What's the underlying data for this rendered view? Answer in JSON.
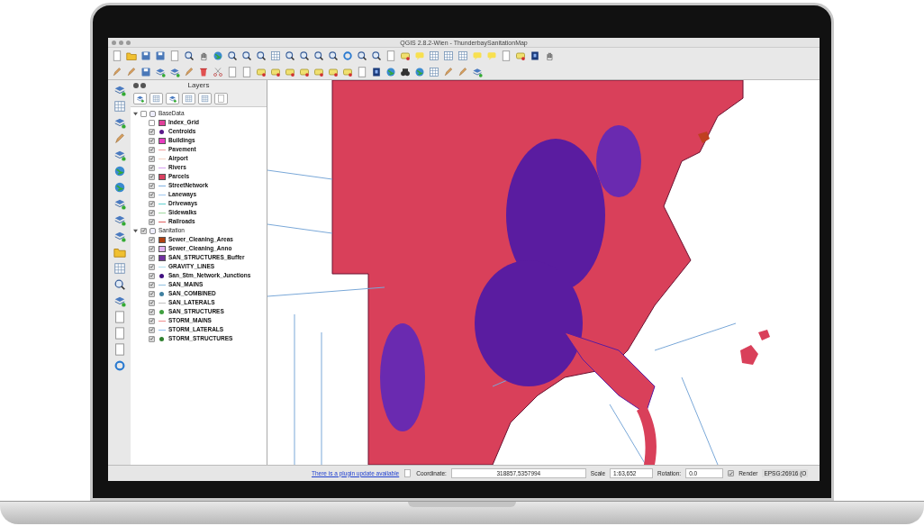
{
  "window": {
    "title": "QGIS 2.8.2-Wien - ThunderbaySanitationMap"
  },
  "layers_panel": {
    "title": "Layers",
    "groups": [
      {
        "name": "BaseData",
        "checked": false,
        "expanded": true,
        "children": [
          {
            "name": "Index_Grid",
            "checked": false,
            "kind": "fill",
            "color": "#e0409a"
          },
          {
            "name": "Centroids",
            "checked": true,
            "kind": "point",
            "color": "#5a1a8a"
          },
          {
            "name": "Buildings",
            "checked": true,
            "kind": "fill",
            "color": "#e83cc0"
          },
          {
            "name": "Pavement",
            "checked": true,
            "kind": "line",
            "color": "#f0a0a0"
          },
          {
            "name": "Airport",
            "checked": true,
            "kind": "line",
            "color": "#f5d0c0"
          },
          {
            "name": "Rivers",
            "checked": true,
            "kind": "line",
            "color": "#d8a0f0"
          },
          {
            "name": "Parcels",
            "checked": true,
            "kind": "fill",
            "color": "#d94060"
          },
          {
            "name": "StreetNetwork",
            "checked": true,
            "kind": "line",
            "color": "#80b0e0"
          },
          {
            "name": "Laneways",
            "checked": true,
            "kind": "line",
            "color": "#a0c8f0"
          },
          {
            "name": "Driveways",
            "checked": true,
            "kind": "line",
            "color": "#60d0d0"
          },
          {
            "name": "Sidewalks",
            "checked": true,
            "kind": "line",
            "color": "#a0d8a0"
          },
          {
            "name": "Railroads",
            "checked": true,
            "kind": "line",
            "color": "#e06060"
          }
        ]
      },
      {
        "name": "Sanitation",
        "checked": true,
        "expanded": true,
        "children": [
          {
            "name": "Sewer_Cleaning_Areas",
            "checked": true,
            "kind": "fill",
            "color": "#b04010"
          },
          {
            "name": "Sewer_Cleaning_Anno",
            "checked": true,
            "kind": "fill",
            "color": "#e0b0f0"
          },
          {
            "name": "SAN_STRUCTURES_Buffer",
            "checked": true,
            "kind": "fill",
            "color": "#7030a0"
          },
          {
            "name": "GRAVITY_LINES",
            "checked": true,
            "kind": "line",
            "color": "#b0e0f0"
          },
          {
            "name": "San_Stm_Network_Junctions",
            "checked": true,
            "kind": "point",
            "color": "#401080"
          },
          {
            "name": "SAN_MAINS",
            "checked": true,
            "kind": "line",
            "color": "#90c0e0"
          },
          {
            "name": "SAN_COMBINED",
            "checked": true,
            "kind": "point",
            "color": "#4080a0"
          },
          {
            "name": "SAN_LATERALS",
            "checked": true,
            "kind": "line",
            "color": "#c0c0c0"
          },
          {
            "name": "SAN_STRUCTURES",
            "checked": true,
            "kind": "point",
            "color": "#40a040"
          },
          {
            "name": "STORM_MAINS",
            "checked": true,
            "kind": "line",
            "color": "#f09090"
          },
          {
            "name": "STORM_LATERALS",
            "checked": true,
            "kind": "line",
            "color": "#90c0f0"
          },
          {
            "name": "STORM_STRUCTURES",
            "checked": true,
            "kind": "point",
            "color": "#308030"
          }
        ]
      }
    ]
  },
  "status_bar": {
    "plugin_link": "There is a plugin update available",
    "coordinate_label": "Coordinate:",
    "coordinate": "318857,5357994",
    "scale_label": "Scale",
    "scale": "1:63,652",
    "rotation_label": "Rotation:",
    "rotation": "0.0",
    "render_label": "Render",
    "render_checked": true,
    "crs": "EPSG:26916 (O"
  }
}
